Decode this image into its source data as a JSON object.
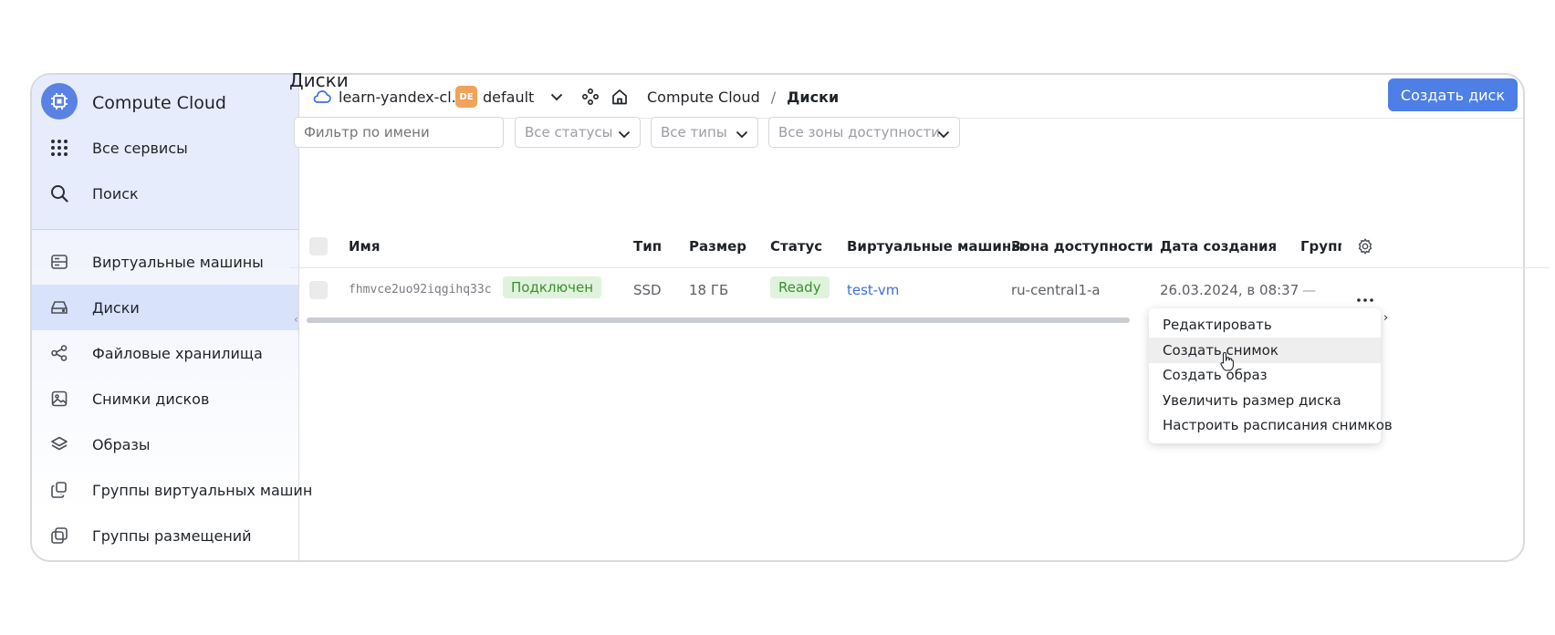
{
  "sidebar": {
    "brand": "Compute Cloud",
    "all_services": "Все сервисы",
    "search": "Поиск",
    "items": [
      {
        "label": "Виртуальные машины",
        "icon": "server-icon"
      },
      {
        "label": "Диски",
        "icon": "disk-icon"
      },
      {
        "label": "Файловые хранилища",
        "icon": "share-nodes-icon"
      },
      {
        "label": "Снимки дисков",
        "icon": "image-icon"
      },
      {
        "label": "Образы",
        "icon": "layers-icon"
      },
      {
        "label": "Группы виртуальных машин",
        "icon": "group-icon"
      },
      {
        "label": "Группы размещений",
        "icon": "placement-group-icon"
      }
    ],
    "active_index": 1
  },
  "header": {
    "cloud": "learn-yandex-cl...",
    "folder_badge": "DE",
    "folder": "default",
    "breadcrumb_service": "Compute Cloud",
    "breadcrumb_separator": "/",
    "breadcrumb_current": "Диски",
    "create_button": "Создать диск"
  },
  "main": {
    "title": "Диски",
    "filters": {
      "name_placeholder": "Фильтр по имени",
      "status": "Все статусы",
      "type": "Все типы",
      "zone": "Все зоны доступности"
    },
    "table": {
      "columns": [
        "Имя",
        "Тип",
        "Размер",
        "Статус",
        "Виртуальные машины",
        "Зона доступности",
        "Дата создания",
        "Группа"
      ],
      "rows": [
        {
          "name": "fhmvce2uo92iqgihq33c",
          "attached": "Подключен",
          "type": "SSD",
          "size": "18 ГБ",
          "status": "Ready",
          "vm": "test-vm",
          "zone": "ru-central1-a",
          "created": "26.03.2024, в 08:37",
          "group": "—"
        }
      ]
    }
  },
  "context_menu": {
    "items": [
      "Редактировать",
      "Создать снимок",
      "Создать образ",
      "Увеличить размер диска",
      "Настроить расписания снимков"
    ],
    "hover_index": 1
  },
  "colors": {
    "accent": "#4d7fe6",
    "sidebar_bg": "#e7ecfc",
    "sidebar_active": "#d8e2fb",
    "status_green_bg": "#dff3dc",
    "status_green_text": "#3a8f2e"
  }
}
